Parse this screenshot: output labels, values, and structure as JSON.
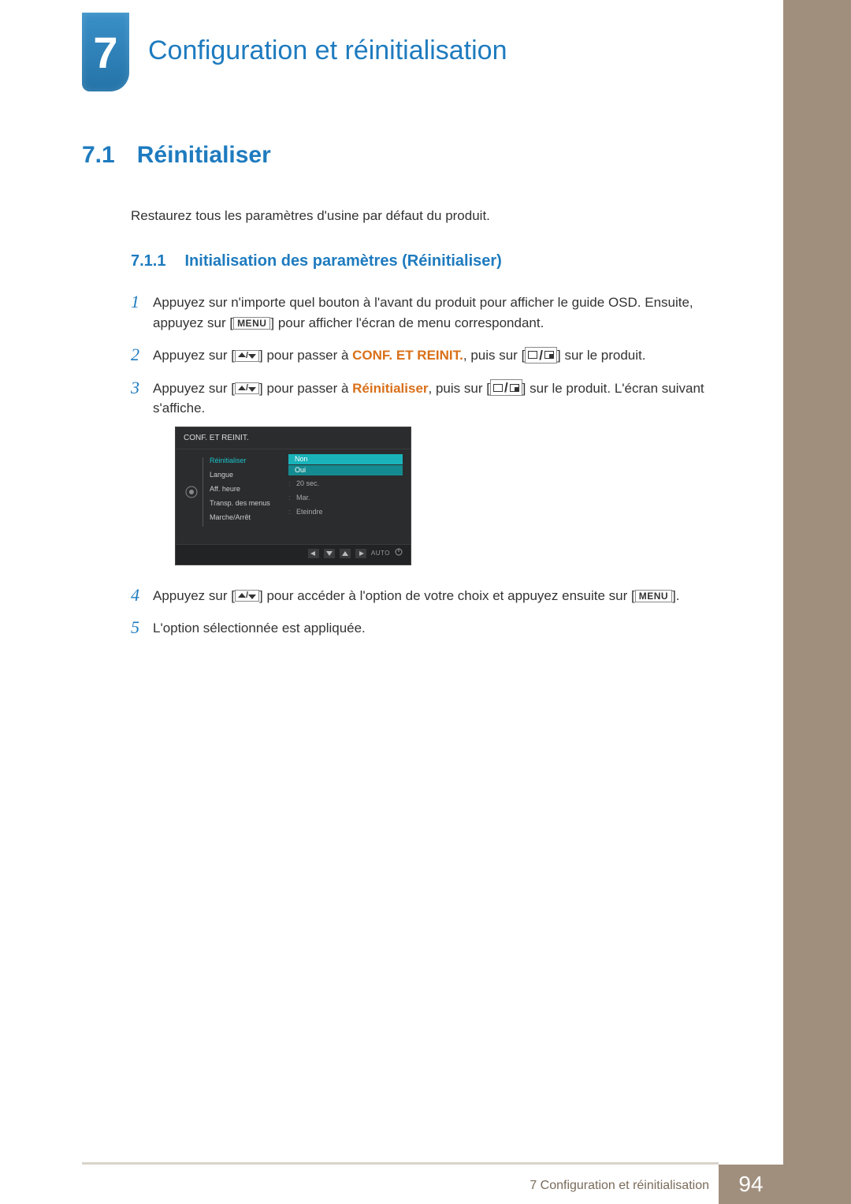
{
  "chapter": {
    "number": "7",
    "title": "Configuration et réinitialisation"
  },
  "section": {
    "number": "7.1",
    "title": "Réinitialiser",
    "intro": "Restaurez tous les paramètres d'usine par défaut du produit."
  },
  "subsection": {
    "number": "7.1.1",
    "title": "Initialisation des paramètres (Réinitialiser)"
  },
  "steps": {
    "s1_a": "Appuyez sur n'importe quel bouton à l'avant du produit pour afficher le guide OSD. Ensuite, appuyez sur [",
    "s1_b": "] pour afficher l'écran de menu correspondant.",
    "s2_a": "Appuyez sur [",
    "s2_b": "] pour passer à ",
    "s2_hl": "CONF. ET REINIT.",
    "s2_c": ", puis sur [",
    "s2_d": "] sur le produit.",
    "s3_a": "Appuyez sur [",
    "s3_b": "] pour passer à ",
    "s3_hl": "Réinitialiser",
    "s3_c": ", puis sur [",
    "s3_d": "] sur le produit. L'écran suivant s'affiche.",
    "s4_a": "Appuyez sur [",
    "s4_b": "] pour accéder à l'option de votre choix et appuyez ensuite sur [",
    "s4_c": "].",
    "s5": "L'option sélectionnée est appliquée."
  },
  "menu_key": "MENU",
  "osd": {
    "title": "CONF. ET REINIT.",
    "rows": [
      {
        "label": "Réinitialiser",
        "value": ""
      },
      {
        "label": "Langue",
        "value": ""
      },
      {
        "label": "Aff. heure",
        "value": "20 sec."
      },
      {
        "label": "Transp. des menus",
        "value": "Mar."
      },
      {
        "label": "Marche/Arrêt",
        "value": "Eteindre"
      }
    ],
    "options": {
      "selected": "Non",
      "other": "Oui"
    },
    "auto": "AUTO"
  },
  "footer": {
    "text": "7 Configuration et réinitialisation",
    "page": "94"
  }
}
